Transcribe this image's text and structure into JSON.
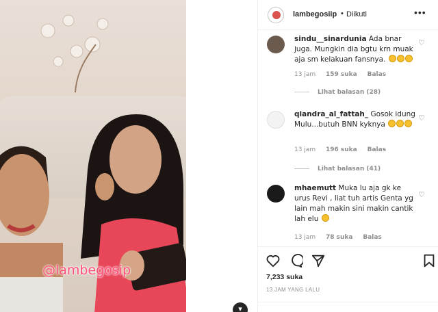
{
  "media": {
    "watermark": "@lambegosip"
  },
  "header": {
    "username": "lambegosiip",
    "separator": "•",
    "follow_status": "Diikuti",
    "more": "•••"
  },
  "comments": [
    {
      "username": "sindu__sinardunia",
      "text": "Ada bnar juga. Mungkin dia bgtu krn muak aja sm kelakuan fansnya.",
      "emojis": 3,
      "time": "13 jam",
      "likes": "159 suka",
      "reply": "Balas",
      "view_replies": "Lihat balasan (28)",
      "avatar_color": "#6b5a4e"
    },
    {
      "username": "qiandra_al_fattah_",
      "text": "Gosok idung Mulu...butuh BNN kyknya",
      "emojis": 3,
      "time": "13 jam",
      "likes": "196 suka",
      "reply": "Balas",
      "view_replies": "Lihat balasan (41)",
      "avatar_color": "#f3f3f3"
    },
    {
      "username": "mhaemutt",
      "text": "Muka lu aja gk ke urus Revi , liat tuh artis Genta yg lain mah makin sini makin cantik lah elu",
      "emojis": 1,
      "time": "13 jam",
      "likes": "78 suka",
      "reply": "Balas",
      "avatar_color": "#1a1a1a"
    }
  ],
  "actions": {
    "like_count": "7,233 suka",
    "timestamp": "13 JAM YANG LALU",
    "icons": [
      "heart-icon",
      "comment-icon",
      "share-icon",
      "bookmark-icon"
    ]
  },
  "colors": {
    "watermark": "#ff4f7a",
    "emoji": "#f7c02e"
  }
}
